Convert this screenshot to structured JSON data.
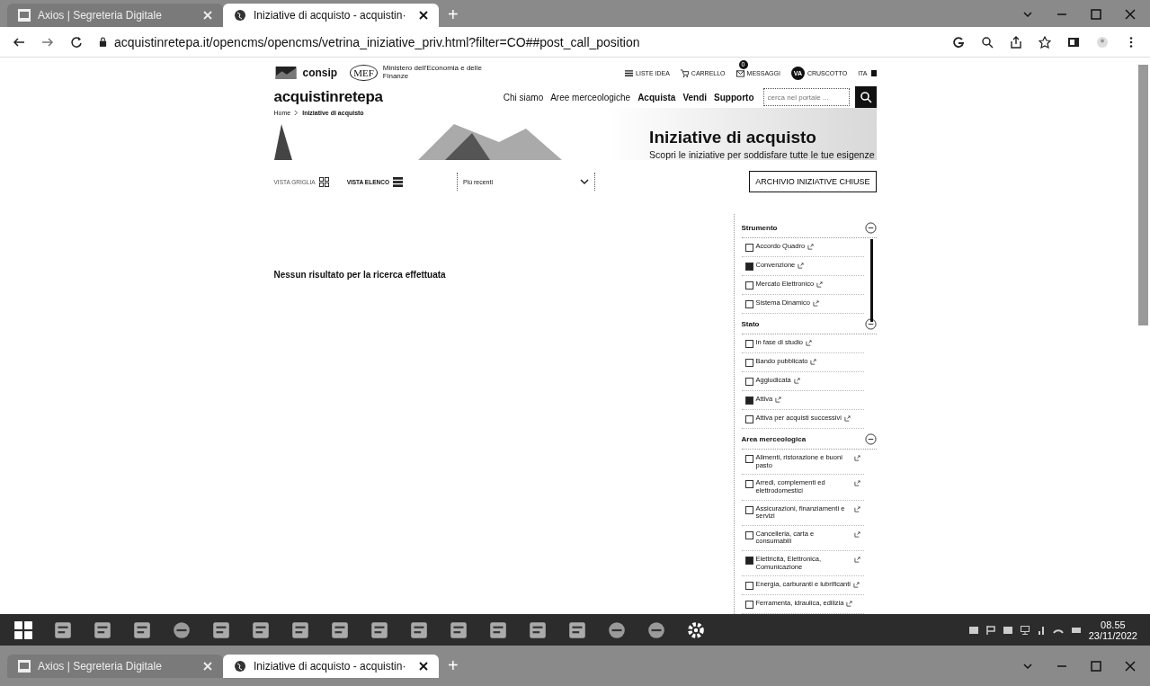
{
  "browser": {
    "tabs": [
      {
        "title": "Axios | Segreteria Digitale",
        "selected": false
      },
      {
        "title": "Iniziative di acquisto - acquistin·",
        "selected": true
      }
    ],
    "new_tab": "+",
    "bottom_tabs": [
      {
        "title": "Axios | Segreteria Digitale",
        "selected": false
      },
      {
        "title": "Iniziative di acquisto - acquistin·",
        "selected": true
      }
    ],
    "bottom_new_tab": "+",
    "url": "acquistinretepa.it/opencms/opencms/vetrina_iniziative_priv.html?filter=CO##post_call_position"
  },
  "header": {
    "consip": "consip",
    "mef": "MEF",
    "ministry": "Ministero dell'Economia e delle Finanze",
    "links": [
      {
        "label": "LISTE IDEA",
        "kind": "list"
      },
      {
        "label": "CARRELLO",
        "kind": "cart"
      },
      {
        "label": "MESSAGGI",
        "kind": "mail",
        "badge": "0"
      },
      {
        "label": "CRUSCOTTO",
        "kind": "avatar",
        "avatar": "VA"
      }
    ],
    "language": "ITA"
  },
  "nav": {
    "brand": "acquistinretepa",
    "items": [
      "Chi siamo",
      "Aree merceologiche",
      "Acquista",
      "Vendi",
      "Supporto"
    ],
    "search": {
      "placeholder": "cerca nel portale ..."
    }
  },
  "breadcrumb": [
    "Home",
    "Iniziative di acquisto"
  ],
  "hero": {
    "title": "Iniziative di acquisto",
    "subtitle": "Scopri le iniziative per soddisfare tutte le tue esigenze"
  },
  "toolbar": {
    "views": [
      {
        "label": "VISTA GRIGLIA",
        "kind": "grid",
        "selected": false
      },
      {
        "label": "VISTA ELENCO",
        "kind": "list",
        "selected": true
      }
    ],
    "sort": "Più recenti",
    "archive_button": "ARCHIVIO INIZIATIVE CHIUSE"
  },
  "empty_message": "Nessun risultato per la ricerca effettuata",
  "filters": [
    {
      "title": "Strumento",
      "expanded": true,
      "items": [
        {
          "label": "Accordo Quadro",
          "checked": false
        },
        {
          "label": "Convenzione",
          "checked": true
        },
        {
          "label": "Mercato Elettronico",
          "checked": false
        },
        {
          "label": "Sistema Dinamico",
          "checked": false
        }
      ]
    },
    {
      "title": "Stato",
      "expanded": true,
      "items": [
        {
          "label": "In fase di studio",
          "checked": false
        },
        {
          "label": "Bando pubblicato",
          "checked": false
        },
        {
          "label": "Aggiudicata",
          "checked": false
        },
        {
          "label": "Attiva",
          "checked": true
        },
        {
          "label": "Attiva per acquisti successivi",
          "checked": false
        }
      ]
    },
    {
      "title": "Area merceologica",
      "expanded": true,
      "items": [
        {
          "label": "Alimenti, ristorazione e buoni pasto",
          "checked": false
        },
        {
          "label": "Arredi, complementi ed elettrodomestici",
          "checked": false
        },
        {
          "label": "Assicurazioni, finanziamenti e servizi",
          "checked": false
        },
        {
          "label": "Cancelleria, carta e consumabili",
          "checked": false
        },
        {
          "label": "Elettricità, Elettronica, Comunicazione",
          "checked": true
        },
        {
          "label": "Energia, carburanti e lubrificanti",
          "checked": false
        },
        {
          "label": "Ferramenta, idraulica, edilizia",
          "checked": false
        }
      ]
    }
  ],
  "taskbar": {
    "apps": [
      {
        "kind": "start"
      },
      {
        "kind": "drawing"
      },
      {
        "kind": "pen"
      },
      {
        "kind": "folder"
      },
      {
        "kind": "firefox"
      },
      {
        "kind": "document"
      },
      {
        "kind": "powerpoint"
      },
      {
        "kind": "word"
      },
      {
        "kind": "excel"
      },
      {
        "kind": "map"
      },
      {
        "kind": "people"
      },
      {
        "kind": "teams"
      },
      {
        "kind": "search"
      },
      {
        "kind": "axios"
      },
      {
        "kind": "files"
      },
      {
        "kind": "ie"
      },
      {
        "kind": "edge"
      },
      {
        "kind": "gear"
      }
    ],
    "time": "08.55",
    "date": "23/11/2022"
  }
}
